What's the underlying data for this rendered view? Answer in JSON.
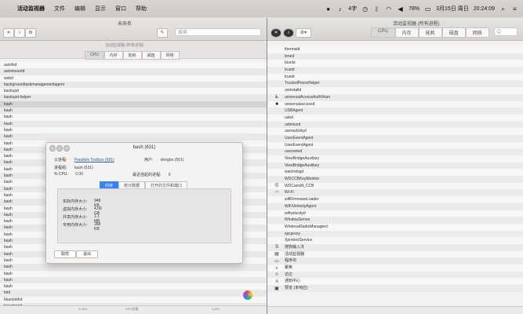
{
  "menubar": {
    "app_name": "活动监视器",
    "items": [
      "文件",
      "编辑",
      "显示",
      "窗口",
      "帮助"
    ],
    "status": {
      "input_method": "4字",
      "battery": "78%",
      "date": "3月15日 周日",
      "time": "20:24:09"
    }
  },
  "left_window": {
    "title": "未命名",
    "subtitle": "活动监视器 (所有进程)",
    "search_placeholder": "搜索",
    "tabs": [
      "CPU",
      "内存",
      "能耗",
      "磁盘",
      "网络"
    ],
    "processes": [
      "autofsd",
      "automountd",
      "webd",
      "backgroundtaskmanagementagent",
      "backupd",
      "backupd-helper",
      "bash",
      "bash",
      "bash",
      "bash",
      "bash",
      "bash",
      "bash",
      "bash",
      "bash",
      "bash",
      "bash",
      "bash",
      "bash",
      "bash",
      "bash",
      "bash",
      "bash",
      "bash",
      "bash",
      "bash",
      "bash",
      "bash",
      "bash",
      "bash",
      "bash",
      "bash",
      "bash",
      "bash",
      "bash",
      "bird",
      "bluetoothd",
      "boostrostd",
      "bsdtar",
      "bsdtar"
    ],
    "footer": {
      "load": "3.02%",
      "cpu_label": "CPU负载",
      "threads": "1,572"
    }
  },
  "dialog": {
    "title": "bash (631)",
    "parent_label": "父进程:",
    "parent_value": "Parallels Toolbox (581)",
    "user_label": "用户:",
    "user_value": "dongbo (501)",
    "group_label": "进程组:",
    "group_value": "bash (631)",
    "cpu_label": "% CPU:",
    "cpu_value": "0.00",
    "recent_label": "最近挂起的进程:",
    "recent_value": "0",
    "tabs": [
      "内存",
      "统计数据",
      "打开的文件和端口"
    ],
    "memory": [
      {
        "label": "实际内存大小:",
        "value": "948 KB"
      },
      {
        "label": "虚拟内存大小:",
        "value": "4.09 GB"
      },
      {
        "label": "共享内存大小:",
        "value": "1.1 MB"
      },
      {
        "label": "专用内存大小:",
        "value": "288 KB"
      }
    ],
    "sample_button": "取样",
    "quit_button": "退出"
  },
  "right_window": {
    "title": "活动监视器 (所有进程)",
    "tabs": [
      "CPU",
      "内存",
      "能耗",
      "磁盘",
      "网络"
    ],
    "search_placeholder": "Q",
    "processes": [
      {
        "name": "thermald",
        "icon": ""
      },
      {
        "name": "timed",
        "icon": ""
      },
      {
        "name": "tourist",
        "icon": ""
      },
      {
        "name": "trustd",
        "icon": ""
      },
      {
        "name": "trustd",
        "icon": ""
      },
      {
        "name": "TrustedPeersHelper",
        "icon": ""
      },
      {
        "name": "uninstalld",
        "icon": ""
      },
      {
        "name": "universalAccessAuthWarn",
        "icon": "accessibility-icon"
      },
      {
        "name": "universalaccessd",
        "icon": "black-square-icon"
      },
      {
        "name": "USBAgent",
        "icon": ""
      },
      {
        "name": "usbd",
        "icon": ""
      },
      {
        "name": "usbmuxd",
        "icon": ""
      },
      {
        "name": "useractivityd",
        "icon": ""
      },
      {
        "name": "UserEventAgent",
        "icon": ""
      },
      {
        "name": "UserEventAgent",
        "icon": ""
      },
      {
        "name": "usernoted",
        "icon": ""
      },
      {
        "name": "ViewBridgeAuxiliary",
        "icon": ""
      },
      {
        "name": "ViewBridgeAuxiliary",
        "icon": ""
      },
      {
        "name": "watchdogd",
        "icon": ""
      },
      {
        "name": "WDCCBKeyMonitor",
        "icon": ""
      },
      {
        "name": "WDCanvM_CCB",
        "icon": "c-icon"
      },
      {
        "name": "Wi-Fi",
        "icon": "wifi-icon"
      },
      {
        "name": "wifiFirmwareLoader",
        "icon": ""
      },
      {
        "name": "WiFiVelocityAgent",
        "icon": ""
      },
      {
        "name": "wifivelocityd",
        "icon": ""
      },
      {
        "name": "WindowServer",
        "icon": ""
      },
      {
        "name": "WirelessRadioManagerd",
        "icon": ""
      },
      {
        "name": "xpcproxy",
        "icon": ""
      },
      {
        "name": "XprotectService",
        "icon": ""
      },
      {
        "name": "搜狗输入法",
        "icon": "sogou-icon"
      },
      {
        "name": "活动监视器",
        "icon": "activity-monitor-icon"
      },
      {
        "name": "程序坞",
        "icon": "dock-icon"
      },
      {
        "name": "聚焦",
        "icon": "spotlight-icon"
      },
      {
        "name": "访达",
        "icon": "finder-icon"
      },
      {
        "name": "通知中心",
        "icon": "notification-center-icon"
      },
      {
        "name": "预览 (未响应)",
        "icon": "preview-icon"
      }
    ]
  }
}
